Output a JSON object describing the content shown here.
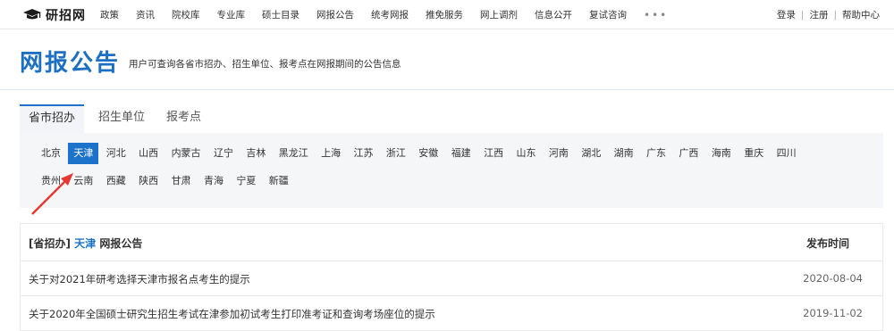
{
  "site": {
    "name": "研招网"
  },
  "nav": {
    "items": [
      "政策",
      "资讯",
      "院校库",
      "专业库",
      "硕士目录",
      "网报公告",
      "统考网报",
      "推免服务",
      "网上调剂",
      "信息公开",
      "复试咨询"
    ],
    "more": "•••"
  },
  "user": {
    "login": "登录",
    "register": "注册",
    "help": "帮助中心",
    "sep": "|"
  },
  "banner": {
    "title": "网报公告",
    "subtitle": "用户可查询各省市招办、招生单位、报考点在网报期间的公告信息"
  },
  "tabs": [
    "省市招办",
    "招生单位",
    "报考点"
  ],
  "regions": {
    "row1": [
      "北京",
      "天津",
      "河北",
      "山西",
      "内蒙古",
      "辽宁",
      "吉林",
      "黑龙江",
      "上海",
      "江苏",
      "浙江",
      "安徽",
      "福建",
      "江西",
      "山东",
      "河南",
      "湖北",
      "湖南",
      "广东",
      "广西",
      "海南",
      "重庆",
      "四川"
    ],
    "row2": [
      "贵州",
      "云南",
      "西藏",
      "陕西",
      "甘肃",
      "青海",
      "宁夏",
      "新疆"
    ],
    "selected": "天津"
  },
  "table": {
    "prefix": "[省招办]",
    "region": "天津",
    "suffix": "网报公告",
    "date_header": "发布时间",
    "rows": [
      {
        "title": "关于对2021年研考选择天津市报名点考生的提示",
        "date": "2020-08-04"
      },
      {
        "title": "关于2020年全国硕士研究生招生考试在津参加初试考生打印准考证和查询考场座位的提示",
        "date": "2019-11-02"
      }
    ]
  },
  "colors": {
    "accent": "#1d73c9",
    "title": "#1d6fc1",
    "arrow": "#e53935"
  }
}
